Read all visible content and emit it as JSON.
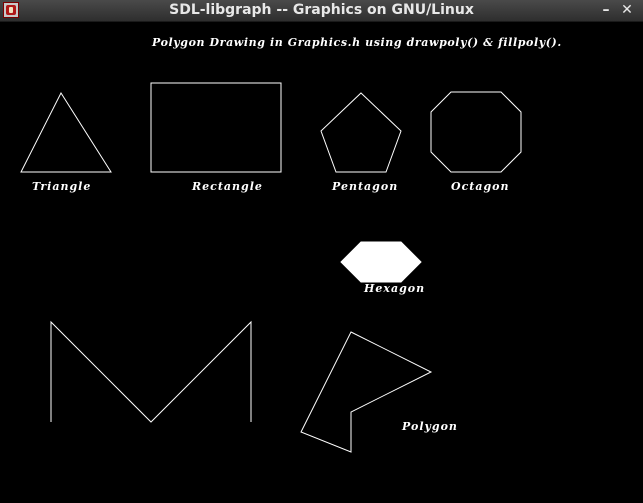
{
  "window": {
    "title": "SDL-libgraph -- Graphics on GNU/Linux",
    "minimize_glyph": "–",
    "close_glyph": "✕",
    "icon": "sdl-app-icon"
  },
  "canvas": {
    "background": "#000000",
    "stroke": "#ffffff",
    "heading": "Polygon Drawing in Graphics.h using drawpoly() & fillpoly().",
    "labels": {
      "triangle": "Triangle",
      "rectangle": "Rectangle",
      "pentagon": "Pentagon",
      "octagon": "Octagon",
      "hexagon": "Hexagon",
      "polygon": "Polygon"
    }
  }
}
